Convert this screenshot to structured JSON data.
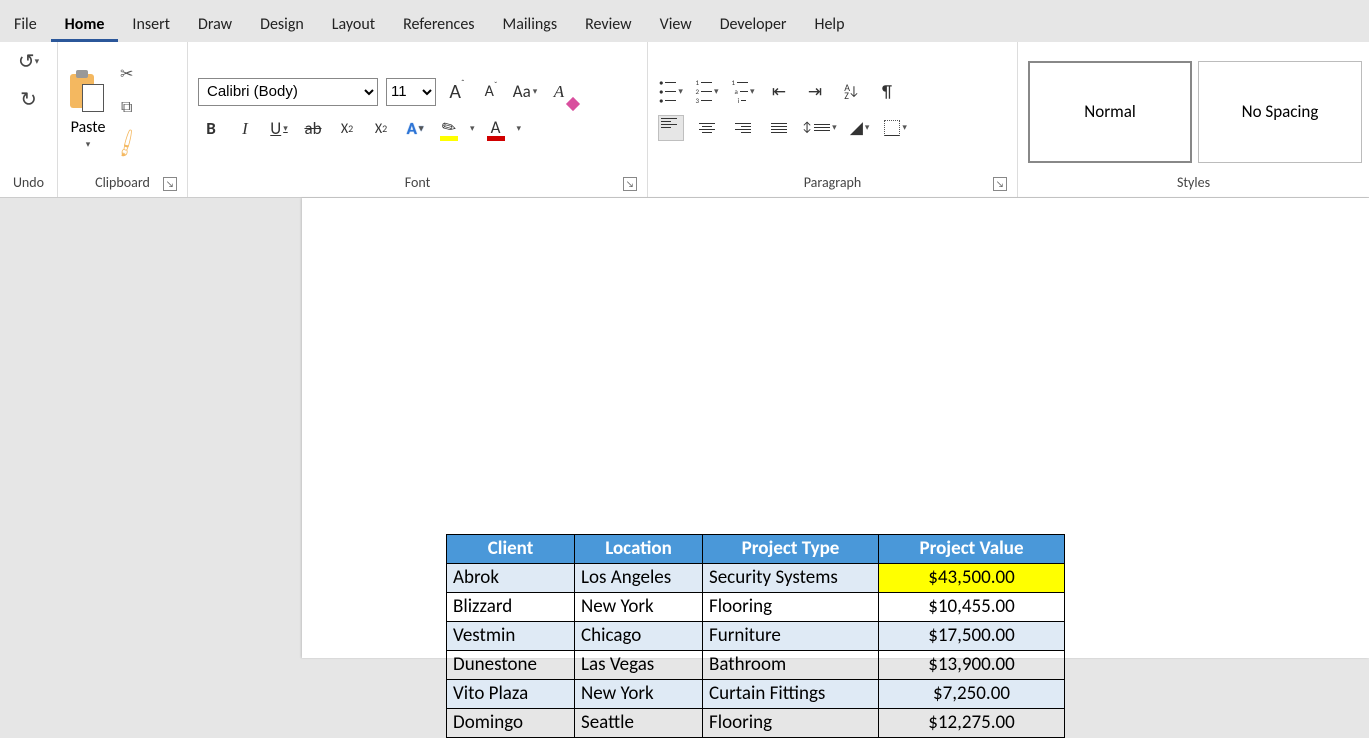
{
  "tabs": {
    "file": "File",
    "home": "Home",
    "insert": "Insert",
    "draw": "Draw",
    "design": "Design",
    "layout": "Layout",
    "references": "References",
    "mailings": "Mailings",
    "review": "Review",
    "view": "View",
    "developer": "Developer",
    "help": "Help"
  },
  "group_labels": {
    "undo": "Undo",
    "clipboard": "Clipboard",
    "font": "Font",
    "paragraph": "Paragraph",
    "styles": "Styles"
  },
  "clipboard": {
    "paste_label": "Paste"
  },
  "font": {
    "font_name": "Calibri (Body)",
    "font_size": "11",
    "grow_A": "A",
    "shrink_A": "A",
    "case_Aa": "Aa",
    "clear_A": "A",
    "bold_B": "B",
    "italic_I": "I",
    "underline_U": "U",
    "strike_ab": "ab",
    "sub_x": "X",
    "sup_x": "X",
    "effect_A": "A",
    "fontcolor_A": "A"
  },
  "paragraph": {
    "sort_label": "A Z",
    "pilcrow": "¶"
  },
  "styles": {
    "items": [
      {
        "label": "Normal",
        "selected": true
      },
      {
        "label": "No Spacing",
        "selected": false
      }
    ]
  },
  "table": {
    "headers": {
      "client": "Client",
      "location": "Location",
      "type": "Project Type",
      "value": "Project Value"
    },
    "rows": [
      {
        "client": "Abrok",
        "location": "Los Angeles",
        "type": "Security Systems",
        "value": "$43,500.00",
        "band": true,
        "highlight_value": true
      },
      {
        "client": "Blizzard",
        "location": "New York",
        "type": "Flooring",
        "value": "$10,455.00",
        "band": false,
        "highlight_value": false
      },
      {
        "client": "Vestmin",
        "location": "Chicago",
        "type": "Furniture",
        "value": "$17,500.00",
        "band": true,
        "highlight_value": false
      },
      {
        "client": "Dunestone",
        "location": "Las Vegas",
        "type": "Bathroom",
        "value": "$13,900.00",
        "band": false,
        "highlight_value": false
      },
      {
        "client": "Vito Plaza",
        "location": "New York",
        "type": "Curtain Fittings",
        "value": "$7,250.00",
        "band": true,
        "highlight_value": false
      },
      {
        "client": "Domingo",
        "location": "Seattle",
        "type": "Flooring",
        "value": "$12,275.00",
        "band": false,
        "highlight_value": false
      }
    ]
  },
  "chart_data": {
    "type": "table",
    "columns": [
      "Client",
      "Location",
      "Project Type",
      "Project Value"
    ],
    "rows": [
      [
        "Abrok",
        "Los Angeles",
        "Security Systems",
        43500.0
      ],
      [
        "Blizzard",
        "New York",
        "Flooring",
        10455.0
      ],
      [
        "Vestmin",
        "Chicago",
        "Furniture",
        17500.0
      ],
      [
        "Dunestone",
        "Las Vegas",
        "Bathroom",
        13900.0
      ],
      [
        "Vito Plaza",
        "New York",
        "Curtain Fittings",
        7250.0
      ],
      [
        "Domingo",
        "Seattle",
        "Flooring",
        12275.0
      ]
    ]
  }
}
